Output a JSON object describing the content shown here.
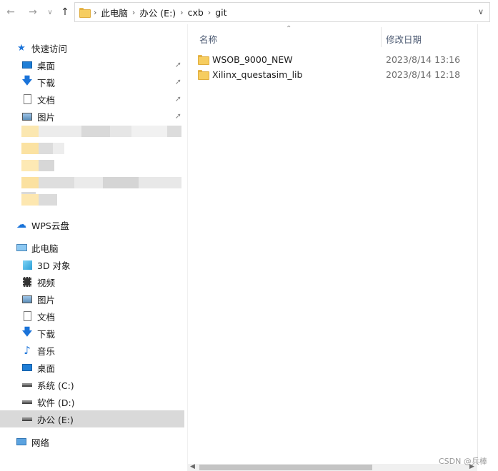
{
  "toolbar": {
    "back_icon": "arrow-left-icon",
    "forward_icon": "arrow-right-icon",
    "recent_icon": "chevron-down-icon",
    "up_icon": "arrow-up-icon"
  },
  "address": {
    "crumbs": [
      "此电脑",
      "办公 (E:)",
      "cxb",
      "git"
    ]
  },
  "nav": {
    "quick_access": "快速访问",
    "quick_items": [
      {
        "label": "桌面",
        "icon": "desktop-icon"
      },
      {
        "label": "下载",
        "icon": "download-icon"
      },
      {
        "label": "文档",
        "icon": "document-icon"
      },
      {
        "label": "图片",
        "icon": "picture-icon"
      }
    ],
    "wps": "WPS云盘",
    "this_pc": "此电脑",
    "pc_items": [
      {
        "label": "3D 对象",
        "icon": "3d-object-icon"
      },
      {
        "label": "视频",
        "icon": "video-icon"
      },
      {
        "label": "图片",
        "icon": "picture-icon"
      },
      {
        "label": "文档",
        "icon": "document-icon"
      },
      {
        "label": "下载",
        "icon": "download-icon"
      },
      {
        "label": "音乐",
        "icon": "music-icon"
      },
      {
        "label": "桌面",
        "icon": "desktop-icon"
      },
      {
        "label": "系统 (C:)",
        "icon": "drive-icon"
      },
      {
        "label": "软件 (D:)",
        "icon": "drive-icon"
      },
      {
        "label": "办公 (E:)",
        "icon": "drive-icon"
      }
    ],
    "network": "网络"
  },
  "columns": {
    "name": "名称",
    "modified": "修改日期"
  },
  "files": [
    {
      "name": "WSOB_9000_NEW",
      "date": "2023/8/14 13:16"
    },
    {
      "name": "Xilinx_questasim_lib",
      "date": "2023/8/14 12:18"
    }
  ],
  "watermark": "CSDN @兵棒",
  "colors": {
    "folder": "#f6cd60",
    "selected": "#d9d9d9",
    "accent_blue": "#1a73d9"
  }
}
